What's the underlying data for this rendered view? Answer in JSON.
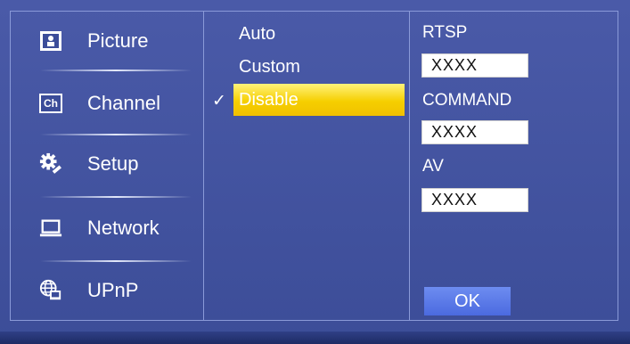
{
  "menu": {
    "items": [
      {
        "label": "Picture",
        "icon": "picture-icon"
      },
      {
        "label": "Channel",
        "icon": "channel-icon",
        "icon_text": "Ch"
      },
      {
        "label": "Setup",
        "icon": "gear-wrench-icon"
      },
      {
        "label": "Network",
        "icon": "monitor-icon"
      },
      {
        "label": "UPnP",
        "icon": "globe-icon"
      }
    ]
  },
  "options": {
    "items": [
      "Auto",
      "Custom",
      "Disable"
    ],
    "selected": "Disable",
    "check_glyph": "✓",
    "highlight_color": "#f6cf00"
  },
  "right_panel": {
    "rtsp_label": "RTSP",
    "rtsp_value": "XXXX",
    "command_label": "COMMAND",
    "command_value": "XXXX",
    "av_label": "AV",
    "av_value": "XXXX",
    "ok_label": "OK"
  }
}
